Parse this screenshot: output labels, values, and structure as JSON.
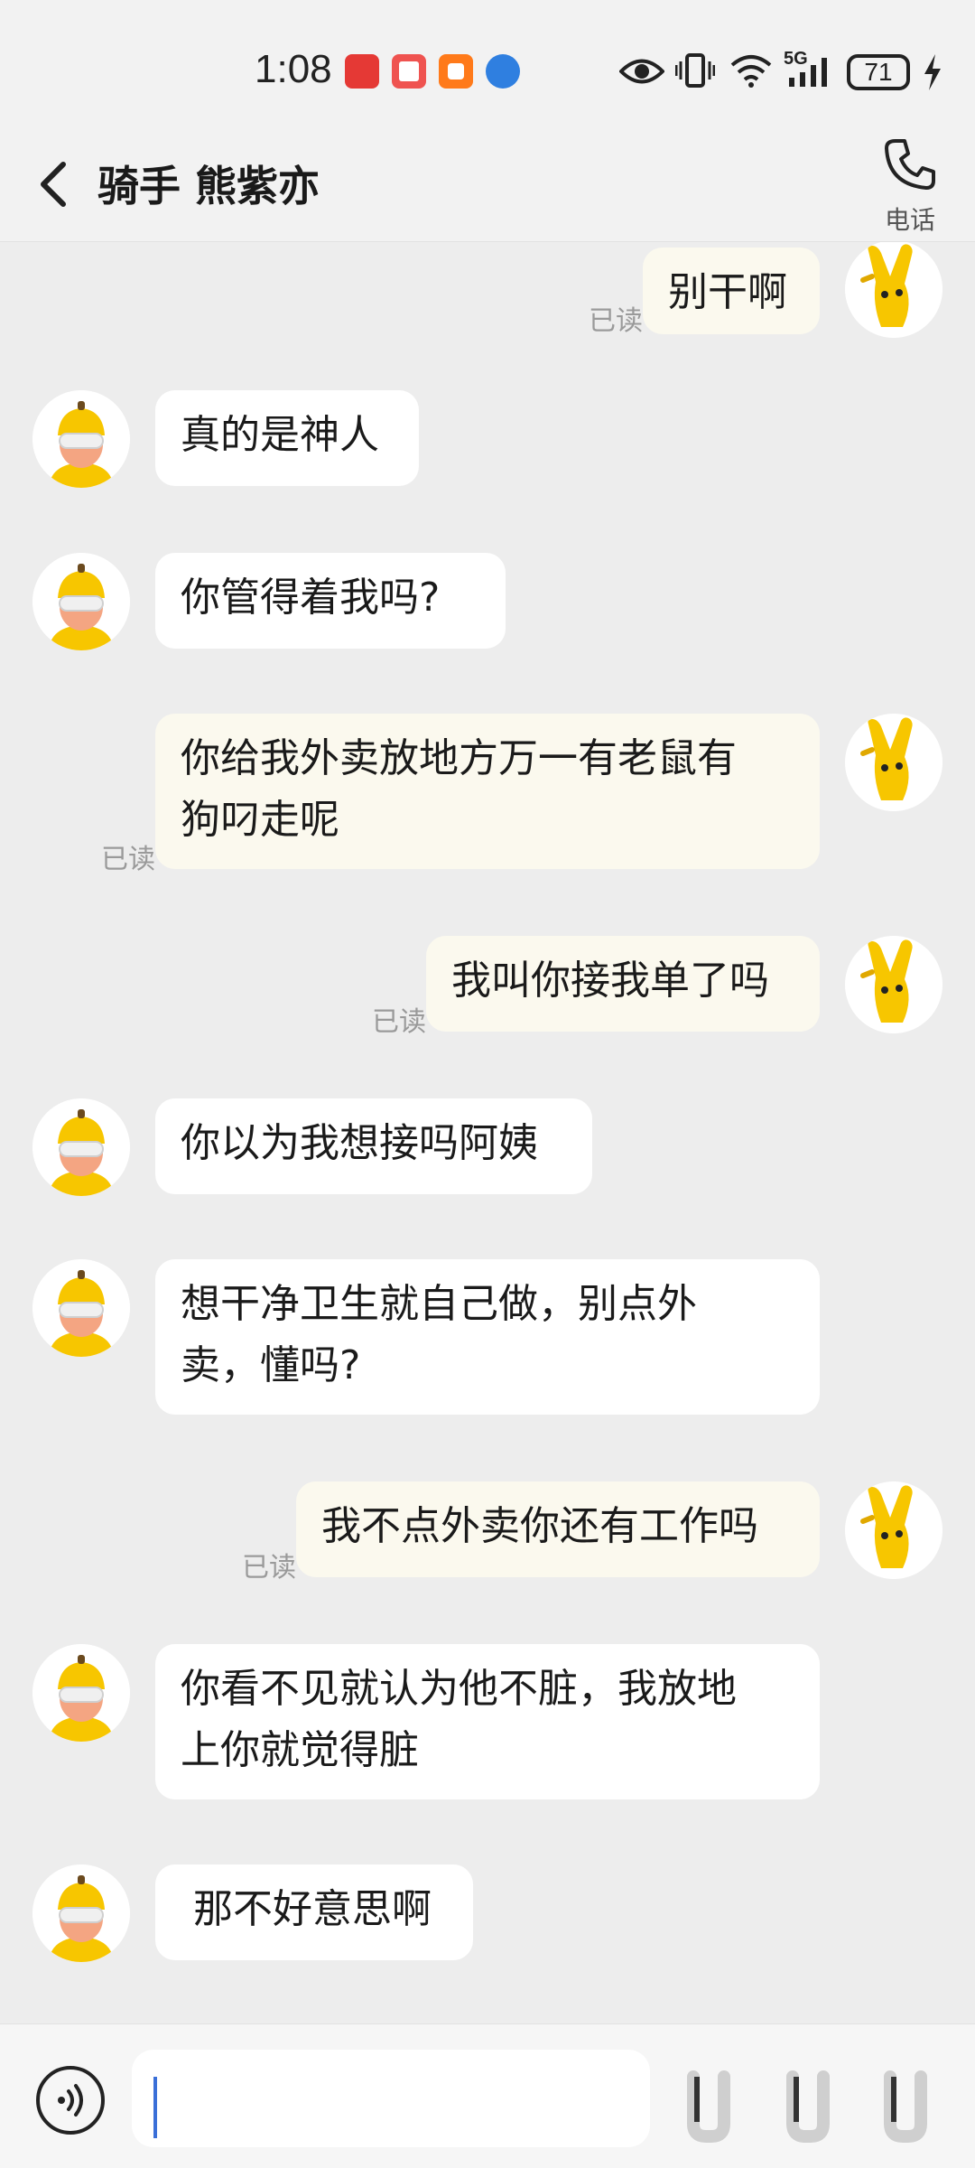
{
  "status_bar": {
    "time": "1:08",
    "battery": "71",
    "network": "5G",
    "icons": [
      "app-notification-icon",
      "book-app-icon",
      "orange-app-icon",
      "browser-app-icon",
      "eye-icon",
      "vibrate-icon",
      "wifi-icon",
      "signal-icon",
      "charging-icon"
    ]
  },
  "header": {
    "title": "骑手 熊紫亦",
    "call_label": "电话",
    "back_icon": "chevron-left-icon",
    "call_icon": "phone-icon"
  },
  "chat": {
    "read_label": "已读",
    "messages": [
      {
        "side": "out",
        "lines": [
          "别干啊"
        ],
        "read": true
      },
      {
        "side": "in",
        "lines": [
          "真的是神人"
        ]
      },
      {
        "side": "in",
        "lines": [
          "你管得着我吗?"
        ]
      },
      {
        "side": "out",
        "lines": [
          "你给我外卖放地方万一有老鼠有",
          "狗叼走呢"
        ],
        "read": true
      },
      {
        "side": "out",
        "lines": [
          "我叫你接我单了吗"
        ],
        "read": true
      },
      {
        "side": "in",
        "lines": [
          "你以为我想接吗阿姨"
        ]
      },
      {
        "side": "in",
        "lines": [
          "想干净卫生就自己做，别点外",
          "卖，懂吗?"
        ]
      },
      {
        "side": "out",
        "lines": [
          "我不点外卖你还有工作吗"
        ],
        "read": true
      },
      {
        "side": "in",
        "lines": [
          "你看不见就认为他不脏，我放地",
          "上你就觉得脏"
        ]
      },
      {
        "side": "in",
        "lines": [
          " 那不好意思啊"
        ]
      }
    ]
  },
  "input": {
    "value": "",
    "voice_icon": "voice-input-icon"
  },
  "colors": {
    "background": "#ededed",
    "incoming_bubble": "#ffffff",
    "outgoing_bubble": "#fbf9ee",
    "read_text": "#9a9a9a",
    "rider_yellow": "#f7c600"
  }
}
